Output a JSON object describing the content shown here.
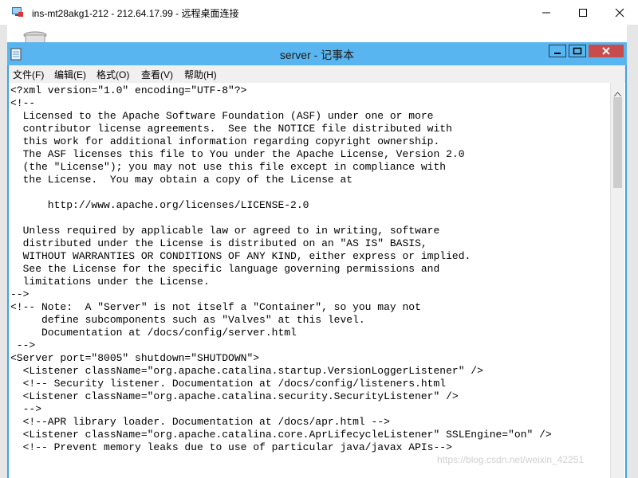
{
  "remote_window": {
    "title": "ins-mt28akg1-212 - 212.64.17.99 - 远程桌面连接"
  },
  "notepad": {
    "title": "server - 记事本",
    "menu": [
      "文件(F)",
      "编辑(E)",
      "格式(O)",
      "查看(V)",
      "帮助(H)"
    ],
    "lines": [
      "<?xml version=\"1.0\" encoding=\"UTF-8\"?>",
      "<!--",
      "  Licensed to the Apache Software Foundation (ASF) under one or more",
      "  contributor license agreements.  See the NOTICE file distributed with",
      "  this work for additional information regarding copyright ownership.",
      "  The ASF licenses this file to You under the Apache License, Version 2.0",
      "  (the \"License\"); you may not use this file except in compliance with",
      "  the License.  You may obtain a copy of the License at",
      "",
      "      http://www.apache.org/licenses/LICENSE-2.0",
      "",
      "  Unless required by applicable law or agreed to in writing, software",
      "  distributed under the License is distributed on an \"AS IS\" BASIS,",
      "  WITHOUT WARRANTIES OR CONDITIONS OF ANY KIND, either express or implied.",
      "  See the License for the specific language governing permissions and",
      "  limitations under the License.",
      "-->",
      "<!-- Note:  A \"Server\" is not itself a \"Container\", so you may not",
      "     define subcomponents such as \"Valves\" at this level.",
      "     Documentation at /docs/config/server.html",
      " -->",
      "<Server port=\"8005\" shutdown=\"SHUTDOWN\">",
      "  <Listener className=\"org.apache.catalina.startup.VersionLoggerListener\" />",
      "  <!-- Security listener. Documentation at /docs/config/listeners.html",
      "  <Listener className=\"org.apache.catalina.security.SecurityListener\" />",
      "  -->",
      "  <!--APR library loader. Documentation at /docs/apr.html -->",
      "  <Listener className=\"org.apache.catalina.core.AprLifecycleListener\" SSLEngine=\"on\" />",
      "  <!-- Prevent memory leaks due to use of particular java/javax APIs-->"
    ]
  },
  "watermark": "https://blog.csdn.net/weixin_42251"
}
